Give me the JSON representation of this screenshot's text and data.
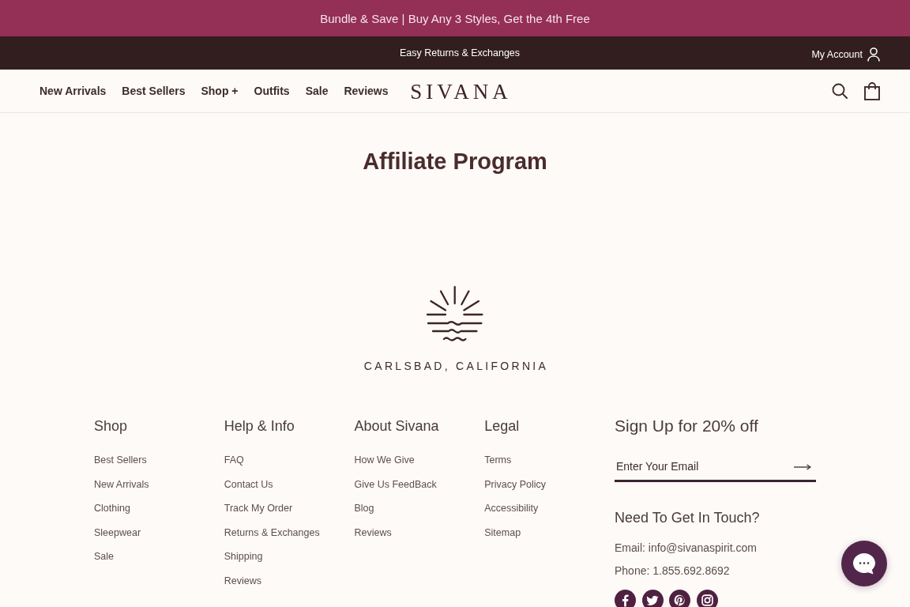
{
  "promo_bar": {
    "text": "Bundle & Save | Buy Any 3 Styles, Get the 4th Free"
  },
  "utility_bar": {
    "message": "Easy Returns & Exchanges",
    "account_link": "My Account"
  },
  "header": {
    "nav_items": [
      {
        "label": "New Arrivals"
      },
      {
        "label": "Best Sellers"
      },
      {
        "label": "Shop +"
      },
      {
        "label": "Outfits"
      },
      {
        "label": "Sale"
      },
      {
        "label": "Reviews"
      }
    ],
    "logo": "SIVANA"
  },
  "page": {
    "title": "Affiliate Program"
  },
  "footer": {
    "location": "CARLSBAD, CALIFORNIA",
    "columns": [
      {
        "heading": "Shop",
        "links": [
          "Best Sellers",
          "New Arrivals",
          "Clothing",
          "Sleepwear",
          "Sale"
        ]
      },
      {
        "heading": "Help & Info",
        "links": [
          "FAQ",
          "Contact Us",
          "Track My Order",
          "Returns & Exchanges",
          "Shipping",
          "Reviews"
        ]
      },
      {
        "heading": "About Sivana",
        "links": [
          "How We Give",
          "Give Us FeedBack",
          "Blog",
          "Reviews"
        ]
      },
      {
        "heading": "Legal",
        "links": [
          "Terms",
          "Privacy Policy",
          "Accessibility",
          "Sitemap"
        ]
      }
    ],
    "signup": {
      "heading": "Sign Up for 20% off",
      "placeholder": "Enter Your Email"
    },
    "contact": {
      "heading": "Need To Get In Touch?",
      "lines": [
        "Email: info@sivanaspirit.com",
        "Phone: 1.855.692.8692"
      ]
    }
  }
}
